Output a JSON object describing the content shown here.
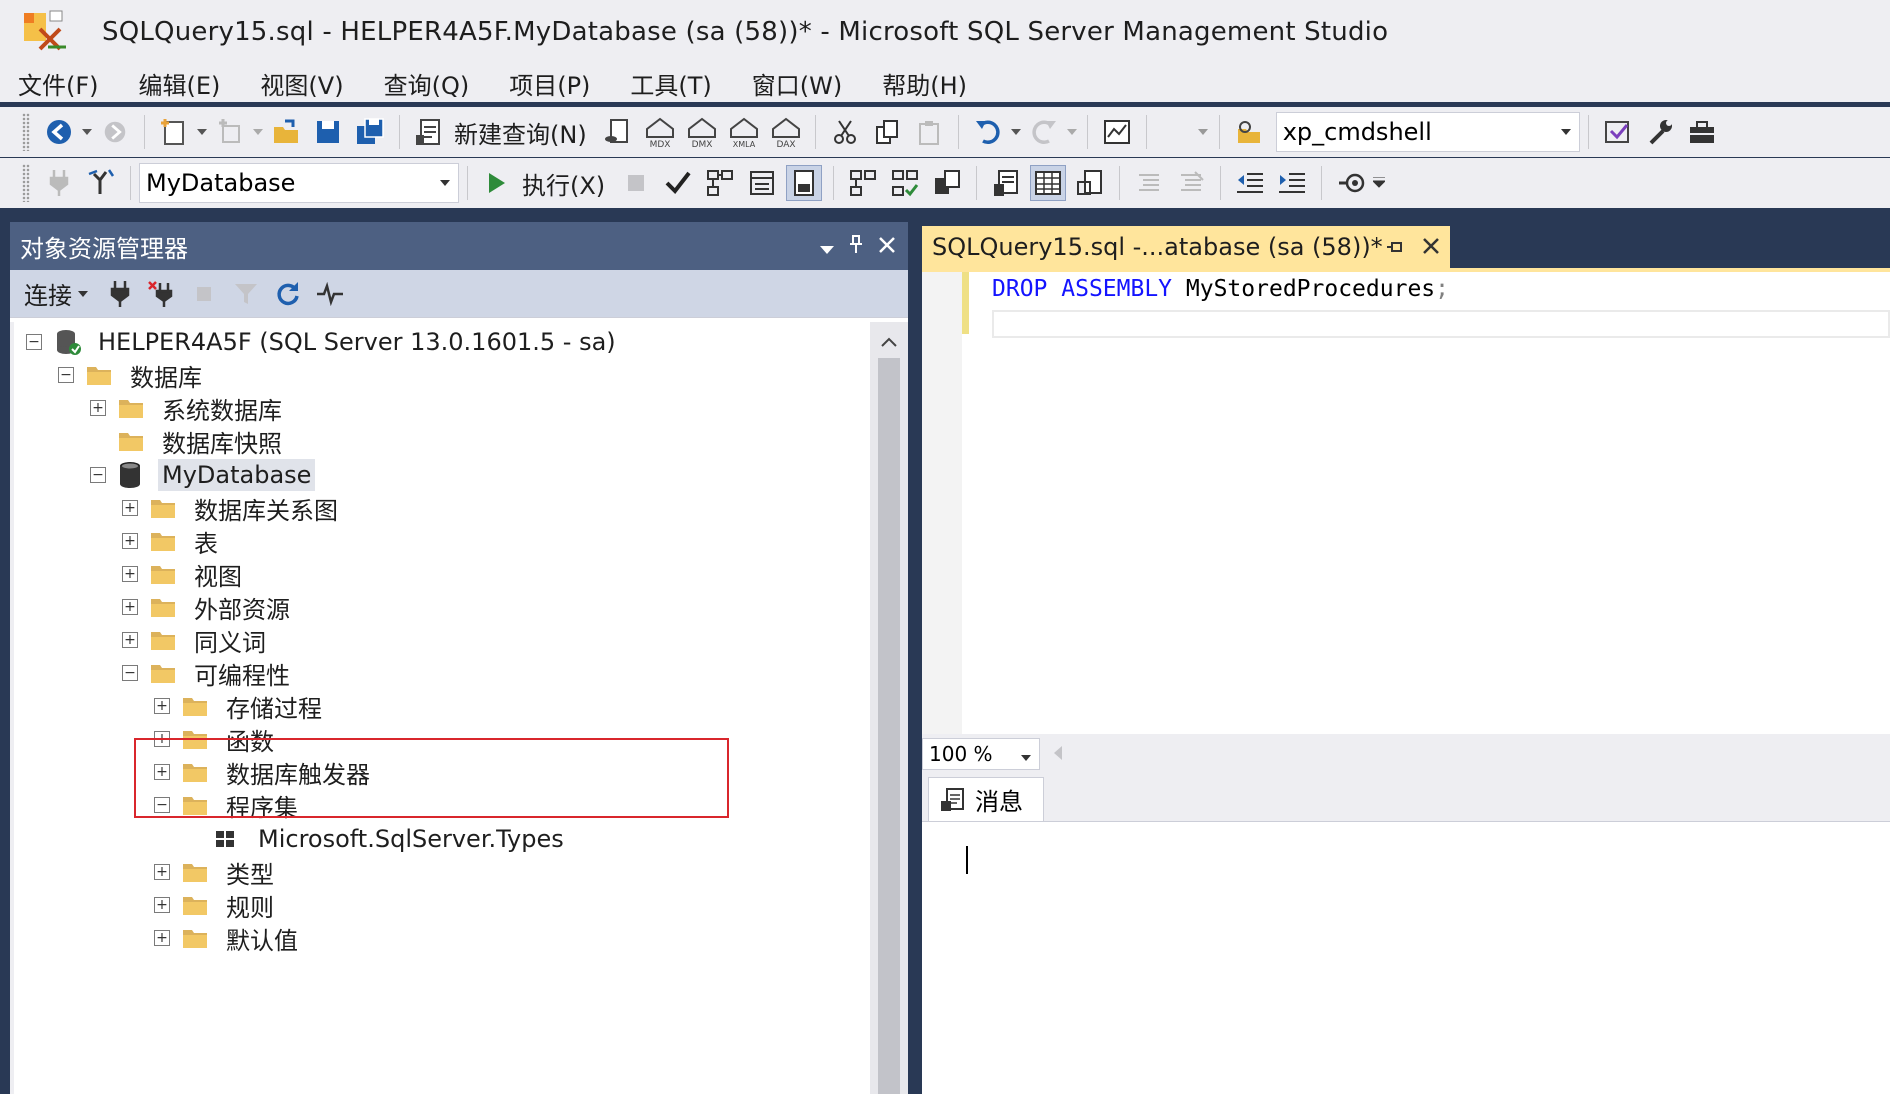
{
  "window": {
    "title": "SQLQuery15.sql - HELPER4A5F.MyDatabase (sa (58))* - Microsoft SQL Server Management Studio"
  },
  "menu": [
    "文件(F)",
    "编辑(E)",
    "视图(V)",
    "查询(Q)",
    "项目(P)",
    "工具(T)",
    "窗口(W)",
    "帮助(H)"
  ],
  "toolbar1": {
    "new_query_label": "新建查询(N)",
    "search_combo_value": "xp_cmdshell",
    "mdx_label": "MDX",
    "dmx_label": "DMX",
    "xmla_label": "XMLA",
    "dax_label": "DAX"
  },
  "toolbar2": {
    "database_combo_value": "MyDatabase",
    "execute_label": "执行(X)"
  },
  "object_explorer": {
    "title": "对象资源管理器",
    "connect_label": "连接",
    "tree": [
      {
        "label": "HELPER4A5F (SQL Server 13.0.1601.5 - sa)",
        "expander": "−"
      },
      {
        "label": "数据库",
        "expander": "−"
      },
      {
        "label": "系统数据库",
        "expander": "+"
      },
      {
        "label": "数据库快照",
        "expander": ""
      },
      {
        "label": "MyDatabase",
        "expander": "−"
      },
      {
        "label": "数据库关系图",
        "expander": "+"
      },
      {
        "label": "表",
        "expander": "+"
      },
      {
        "label": "视图",
        "expander": "+"
      },
      {
        "label": "外部资源",
        "expander": "+"
      },
      {
        "label": "同义词",
        "expander": "+"
      },
      {
        "label": "可编程性",
        "expander": "−"
      },
      {
        "label": "存储过程",
        "expander": "+"
      },
      {
        "label": "函数",
        "expander": "+"
      },
      {
        "label": "数据库触发器",
        "expander": "+"
      },
      {
        "label": "程序集",
        "expander": "−"
      },
      {
        "label": "Microsoft.SqlServer.Types",
        "expander": ""
      },
      {
        "label": "类型",
        "expander": "+"
      },
      {
        "label": "规则",
        "expander": "+"
      },
      {
        "label": "默认值",
        "expander": "+"
      }
    ]
  },
  "editor": {
    "tab_title": "SQLQuery15.sql -...atabase (sa (58))*",
    "code": {
      "kw1": "DROP",
      "kw2": "ASSEMBLY",
      "ident": "MyStoredProcedures",
      "terminator": ";"
    },
    "zoom": "100 %"
  },
  "results": {
    "messages_tab": "消息"
  },
  "colors": {
    "highlight_box": "#d9262c",
    "keyword": "#1414ff",
    "tab_active": "#ffe59c",
    "panel_header": "#4d6082",
    "chrome": "#eeeef2"
  }
}
